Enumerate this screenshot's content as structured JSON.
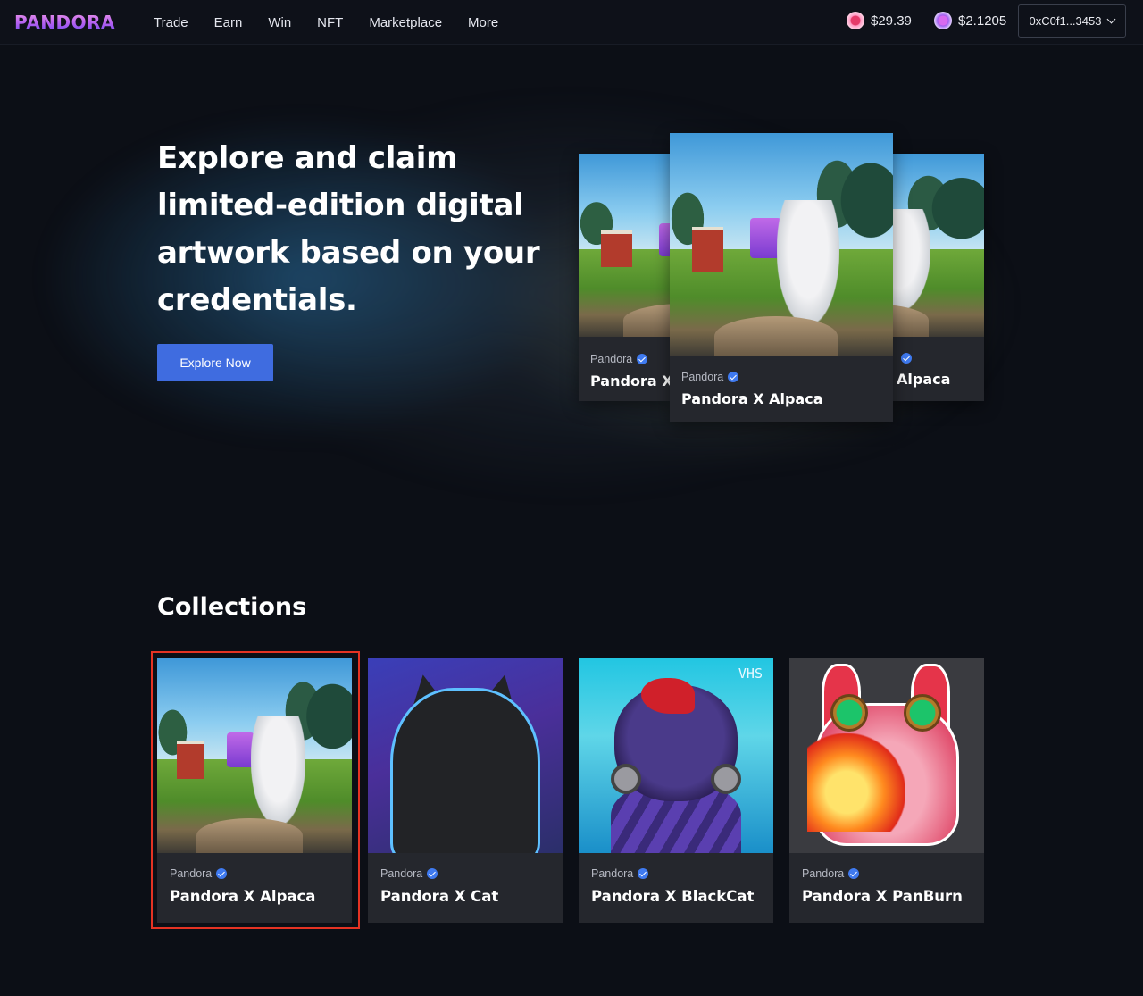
{
  "nav": {
    "logo_text": "PANDORA",
    "links": [
      "Trade",
      "Earn",
      "Win",
      "NFT",
      "Marketplace",
      "More"
    ],
    "token_prices": [
      {
        "icon": "pandora-token-icon",
        "value": "$29.39"
      },
      {
        "icon": "pan-token-icon",
        "value": "$2.1205"
      }
    ],
    "wallet_address": "0xC0f1...3453"
  },
  "hero": {
    "title": "Explore and claim limited-edition digital artwork based on your credentials.",
    "cta_label": "Explore Now",
    "featured_cards": {
      "left": {
        "maker": "Pandora",
        "name": "Pandora X"
      },
      "center": {
        "maker": "Pandora",
        "name": "Pandora X Alpaca"
      },
      "right": {
        "maker": "",
        "name": "Alpaca"
      }
    }
  },
  "collections": {
    "heading": "Collections",
    "items": [
      {
        "maker": "Pandora",
        "name": "Pandora X Alpaca",
        "selected": true
      },
      {
        "maker": "Pandora",
        "name": "Pandora X Cat"
      },
      {
        "maker": "Pandora",
        "name": "Pandora X BlackCat",
        "art_text": "VHS"
      },
      {
        "maker": "Pandora",
        "name": "Pandora X PanBurn"
      }
    ]
  },
  "colors": {
    "background": "#0c0f16",
    "card": "#25272d",
    "accent_button": "#3f6ce0",
    "verified_badge": "#3f7af0",
    "selection_outline": "#e53323"
  }
}
